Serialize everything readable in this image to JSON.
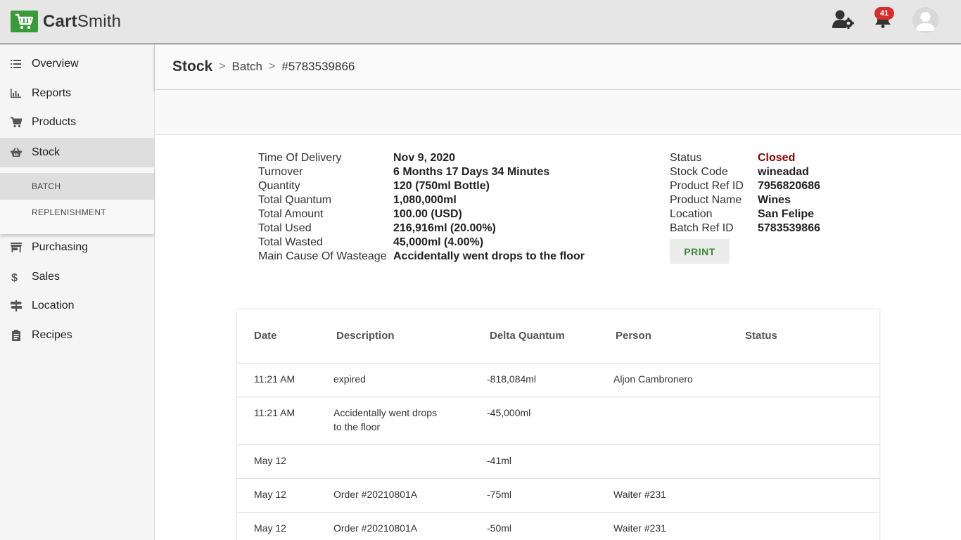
{
  "app": {
    "brand_bold": "Cart",
    "brand_rest": "Smith",
    "notification_count": "41"
  },
  "sidebar": {
    "items": [
      {
        "label": "Overview",
        "icon": "list-icon"
      },
      {
        "label": "Reports",
        "icon": "bar-chart-icon"
      },
      {
        "label": "Products",
        "icon": "cart-icon"
      },
      {
        "label": "Stock",
        "icon": "basket-icon"
      },
      {
        "label": "Purchasing",
        "icon": "store-icon"
      },
      {
        "label": "Sales",
        "icon": "dollar-icon"
      },
      {
        "label": "Location",
        "icon": "signpost-icon"
      },
      {
        "label": "Recipes",
        "icon": "clipboard-icon"
      }
    ],
    "stock_sub": [
      "BATCH",
      "REPLENISHMENT"
    ]
  },
  "breadcrumb": {
    "root": "Stock",
    "sep1": ">",
    "middle": "Batch",
    "sep2": ">",
    "current": "#5783539866"
  },
  "details_left": [
    {
      "key": "Time Of Delivery",
      "value": "Nov 9, 2020"
    },
    {
      "key": "Turnover",
      "value": "6 Months 17 Days 34 Minutes"
    },
    {
      "key": "Quantity",
      "value": "120 (750ml Bottle)"
    },
    {
      "key": "Total Quantum",
      "value": "1,080,000ml"
    },
    {
      "key": "Total Amount",
      "value": "100.00 (USD)"
    },
    {
      "key": "Total Used",
      "value": "216,916ml (20.00%)"
    },
    {
      "key": "Total Wasted",
      "value": "45,000ml (4.00%)"
    },
    {
      "key": "Main Cause Of Wasteage",
      "value": "Accidentally went drops to the floor"
    }
  ],
  "details_right": [
    {
      "key": "Status",
      "value": "Closed"
    },
    {
      "key": "Stock Code",
      "value": "wineadad"
    },
    {
      "key": "Product Ref ID",
      "value": "7956820686"
    },
    {
      "key": "Product Name",
      "value": "Wines"
    },
    {
      "key": "Location",
      "value": "San Felipe"
    },
    {
      "key": "Batch Ref ID",
      "value": "5783539866"
    }
  ],
  "print_label": "PRINT",
  "status_color": "#8b0000",
  "table": {
    "headers": [
      "Date",
      "Description",
      "Delta Quantum",
      "Person",
      "Status"
    ],
    "rows": [
      {
        "date": "11:21 AM",
        "desc": "expired",
        "desc2": "",
        "delta": "-818,084ml",
        "person": "Aljon Cambronero",
        "status": ""
      },
      {
        "date": "11:21 AM",
        "desc": "Accidentally went drops",
        "desc2": "to the floor",
        "delta": "-45,000ml",
        "person": "",
        "status": ""
      },
      {
        "date": "May 12",
        "desc": "",
        "desc2": "",
        "delta": "-41ml",
        "person": "",
        "status": ""
      },
      {
        "date": "May 12",
        "desc": "Order #20210801A",
        "desc2": "",
        "delta": "-75ml",
        "person": "Waiter #231",
        "status": ""
      },
      {
        "date": "May 12",
        "desc": "Order #20210801A",
        "desc2": "",
        "delta": "-50ml",
        "person": "Waiter #231",
        "status": ""
      }
    ]
  }
}
